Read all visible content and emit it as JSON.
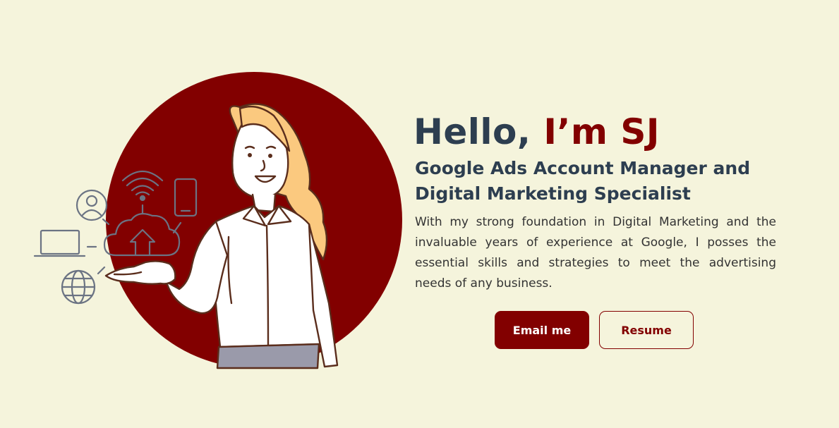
{
  "hero": {
    "greeting_prefix": "Hello,",
    "greeting_name": "I’m SJ",
    "role_line_1": "Google Ads Account Manager and",
    "role_line_2": "Digital Marketing Specialist",
    "bio": "With my strong foundation in Digital Marketing and the invaluable years of experience at Google, I posses the essential skills and strategies to meet the advertising needs of any business.",
    "email_button": "Email me",
    "resume_button": "Resume"
  },
  "colors": {
    "background": "#f5f4dc",
    "accent": "#820000",
    "heading": "#2d3e50",
    "icon_stroke": "#6b7383"
  },
  "icons": [
    "user-icon",
    "wifi-icon",
    "phone-icon",
    "laptop-icon",
    "cloud-upload-icon",
    "globe-icon"
  ]
}
